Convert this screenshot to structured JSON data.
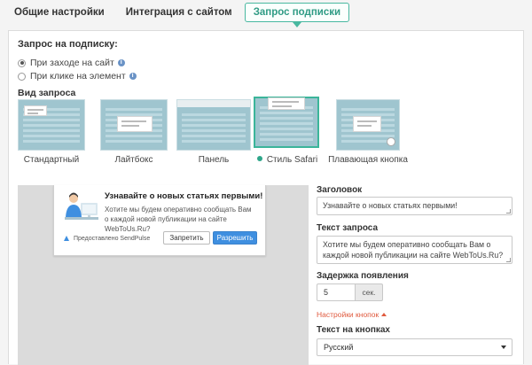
{
  "tabs": [
    {
      "label": "Общие настройки",
      "active": false
    },
    {
      "label": "Интеграция с сайтом",
      "active": false
    },
    {
      "label": "Запрос подписки",
      "active": true
    }
  ],
  "subscription_request": {
    "title": "Запрос на подписку:",
    "options": [
      {
        "label": "При заходе на сайт",
        "selected": true,
        "info_icon": "info-icon"
      },
      {
        "label": "При клике на элемент",
        "selected": false,
        "info_icon": "info-icon"
      }
    ]
  },
  "request_view": {
    "title": "Вид запроса",
    "styles": [
      {
        "label": "Стандартный",
        "selected": false
      },
      {
        "label": "Лайтбокс",
        "selected": false
      },
      {
        "label": "Панель",
        "selected": false
      },
      {
        "label": "Стиль Safari",
        "selected": true
      },
      {
        "label": "Плавающая кнопка",
        "selected": false
      }
    ]
  },
  "preview": {
    "title": "Узнавайте о новых статьях первыми!",
    "text": "Хотите мы будем оперативно сообщать Вам о каждой новой публикации на сайте WebToUs.Ru?",
    "powered_by": "Предоставлено SendPulse",
    "deny_label": "Запретить",
    "allow_label": "Разрешить"
  },
  "form": {
    "heading_label": "Заголовок",
    "heading_value": "Узнавайте о новых статьях первыми!",
    "text_label": "Текст запроса",
    "text_value": "Хотите мы будем оперативно сообщать Вам о каждой новой публикации на сайте WebToUs.Ru?",
    "delay_label": "Задержка появления",
    "delay_value": "5",
    "delay_unit": "сек.",
    "buttons_settings_link": "Настройки кнопок",
    "buttons_text_label": "Текст на кнопках",
    "buttons_text_value": "Русский"
  },
  "colors": {
    "accent": "#49b8a0",
    "allow_button": "#3f8fe0",
    "link": "#e05a3e",
    "card_bg": "#9fc5cf"
  }
}
